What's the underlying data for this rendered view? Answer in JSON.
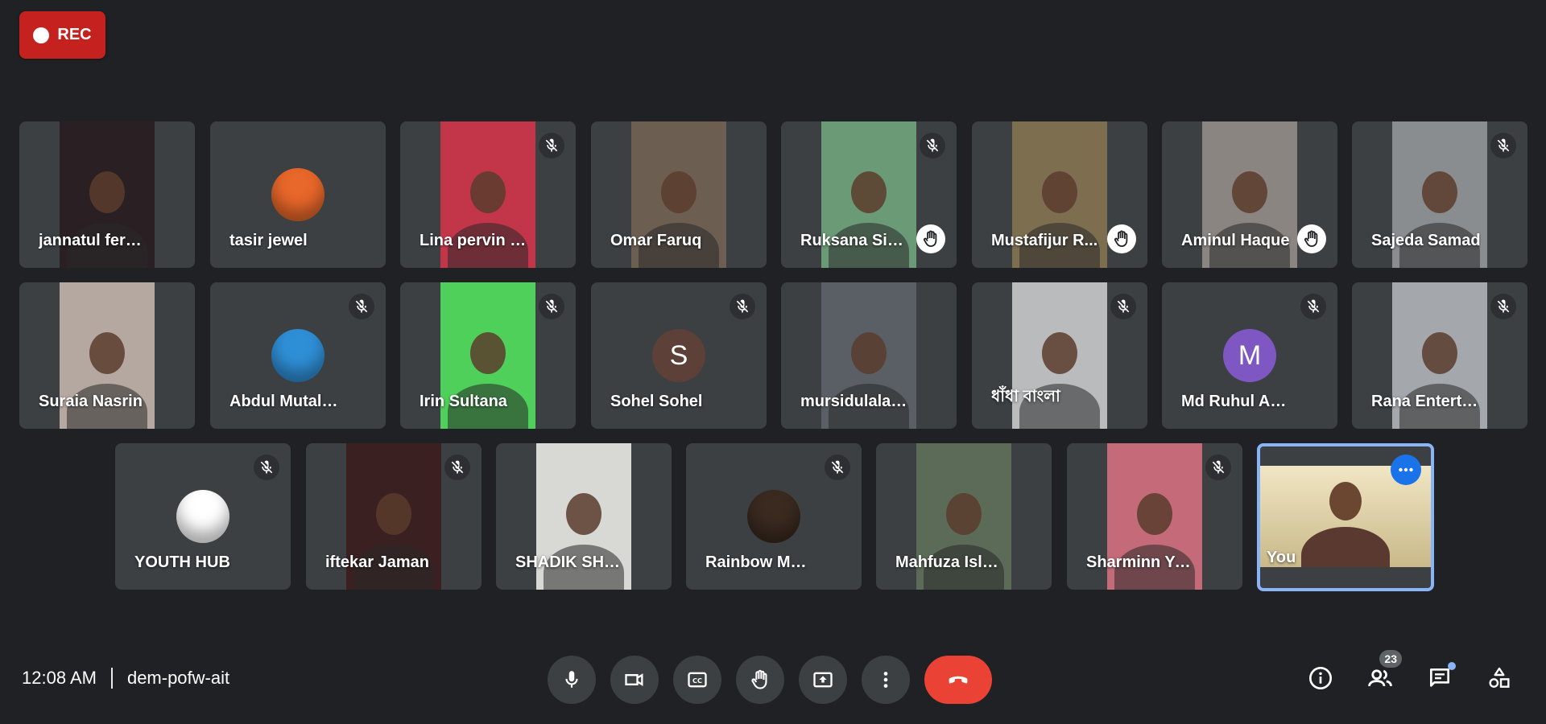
{
  "recording": {
    "label": "REC"
  },
  "participants": [
    {
      "name": "jannatul ferdous",
      "kind": "video",
      "bg": "#2a1f22",
      "muted": false,
      "hand": false
    },
    {
      "name": "tasir jewel",
      "kind": "avatar-img",
      "avatar_bg": "#e8672a",
      "muted": false,
      "hand": false
    },
    {
      "name": "Lina pervin Nila",
      "kind": "video",
      "bg": "#c3364a",
      "muted": true,
      "hand": false
    },
    {
      "name": "Omar Faruq",
      "kind": "video",
      "bg": "#6d5e52",
      "muted": false,
      "hand": false
    },
    {
      "name": "Ruksana Sima",
      "kind": "video",
      "bg": "#6b9a76",
      "muted": true,
      "hand": true
    },
    {
      "name": "Mustafijur R...",
      "kind": "video",
      "bg": "#7d6e50",
      "muted": false,
      "hand": true
    },
    {
      "name": "Aminul Haque",
      "kind": "video",
      "bg": "#8a8580",
      "muted": false,
      "hand": true
    },
    {
      "name": "Sajeda Samad",
      "kind": "video",
      "bg": "#8a8d90",
      "muted": true,
      "hand": false
    },
    {
      "name": "Suraia Nasrin",
      "kind": "video",
      "bg": "#b5a8a0",
      "muted": false,
      "hand": false
    },
    {
      "name": "Abdul Mutalib Ey...",
      "kind": "avatar-img",
      "avatar_bg": "#2f8fd6",
      "muted": true,
      "hand": false
    },
    {
      "name": "Irin Sultana",
      "kind": "video",
      "bg": "#4fd05a",
      "muted": true,
      "hand": false
    },
    {
      "name": "Sohel Sohel",
      "kind": "avatar-letter",
      "letter": "S",
      "avatar_bg": "#5d4037",
      "muted": true,
      "hand": false
    },
    {
      "name": "mursidulalam nu...",
      "kind": "video",
      "bg": "#5a5f66",
      "muted": false,
      "hand": false
    },
    {
      "name": "ধাঁধা বাংলা",
      "kind": "video",
      "bg": "#b9bbbd",
      "muted": true,
      "hand": false
    },
    {
      "name": "Md Ruhul Amin",
      "kind": "avatar-letter",
      "letter": "M",
      "avatar_bg": "#7e57c2",
      "muted": true,
      "hand": false
    },
    {
      "name": "Rana Entertain...",
      "kind": "video",
      "bg": "#a4a7ab",
      "muted": true,
      "hand": false
    },
    {
      "name": "YOUTH HUB",
      "kind": "avatar-img",
      "avatar_bg": "#ffffff",
      "muted": true,
      "hand": false
    },
    {
      "name": "iftekar Jaman",
      "kind": "video",
      "bg": "#3a2020",
      "muted": true,
      "hand": false
    },
    {
      "name": "SHADIK SHAMIM",
      "kind": "video",
      "bg": "#d8d8d4",
      "muted": false,
      "hand": false
    },
    {
      "name": "Rainbow Music",
      "kind": "avatar-img",
      "avatar_bg": "#3a2a20",
      "muted": true,
      "hand": false
    },
    {
      "name": "Mahfuza Islam",
      "kind": "video",
      "bg": "#5c6b58",
      "muted": false,
      "hand": false
    },
    {
      "name": "Sharminn Yasmi...",
      "kind": "video",
      "bg": "#c46a78",
      "muted": true,
      "hand": false
    },
    {
      "name": "You",
      "kind": "self",
      "bg": "#d9c9a0",
      "muted": false,
      "hand": false
    }
  ],
  "footer": {
    "time": "12:08 AM",
    "meeting_code": "dem-pofw-ait",
    "people_count": "23"
  },
  "colors": {
    "end_call": "#ea4335",
    "rec": "#c5221f",
    "accent": "#8ab4f8"
  }
}
